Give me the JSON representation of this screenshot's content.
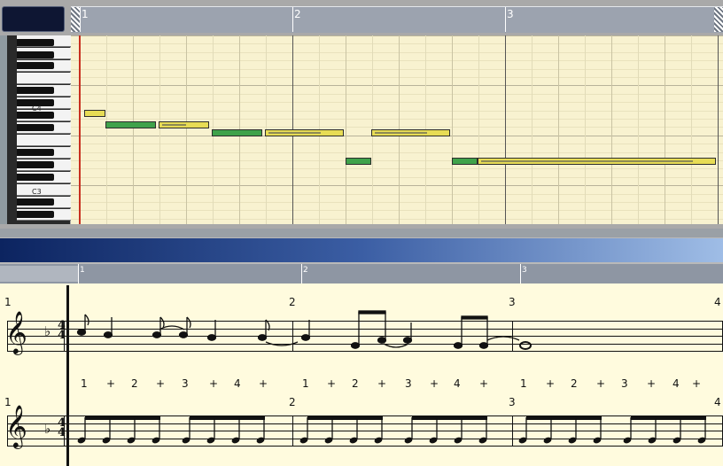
{
  "app": {
    "lcd_text": ""
  },
  "piano_roll": {
    "ruler_bars": [
      "1",
      "2",
      "3"
    ],
    "key_labels": [
      "C4",
      "C3"
    ],
    "notes": [
      {
        "color": "yellow",
        "bar_pos": 1.02,
        "len": 0.1,
        "row": "C4"
      },
      {
        "color": "green",
        "bar_pos": 1.12,
        "len": 0.24,
        "row": "B3"
      },
      {
        "color": "yellow",
        "bar_pos": 1.37,
        "len": 0.24,
        "row": "B3"
      },
      {
        "color": "green",
        "bar_pos": 1.62,
        "len": 0.24,
        "row": "A3"
      },
      {
        "color": "yellow",
        "bar_pos": 1.87,
        "len": 0.37,
        "row": "A3"
      },
      {
        "color": "green",
        "bar_pos": 2.25,
        "len": 0.12,
        "row": "F3"
      },
      {
        "color": "yellow",
        "bar_pos": 2.37,
        "len": 0.37,
        "row": "A3"
      },
      {
        "color": "green",
        "bar_pos": 2.75,
        "len": 0.12,
        "row": "F3"
      },
      {
        "color": "yellow",
        "bar_pos": 2.87,
        "len": 1.12,
        "row": "F3"
      }
    ]
  },
  "score": {
    "ruler_bars": [
      "1",
      "2",
      "3"
    ],
    "measure_numbers": [
      "1",
      "2",
      "3",
      "4"
    ],
    "time_signature": {
      "top": "4",
      "bottom": "4"
    },
    "counts": [
      "1",
      "+",
      "2",
      "+",
      "3",
      "+",
      "4",
      "+",
      "1",
      "+",
      "2",
      "+",
      "3",
      "+",
      "4",
      "+",
      "1",
      "+",
      "2",
      "+",
      "3",
      "+",
      "4",
      "+"
    ],
    "staff2_measure_numbers": [
      "1",
      "2",
      "3",
      "4"
    ]
  },
  "colors": {
    "roll_bg": "#f8f2d0",
    "note_green": "#3fa24a",
    "note_yellow": "#e7dc55",
    "score_bg": "#fffbde",
    "playhead": "#c83020"
  }
}
